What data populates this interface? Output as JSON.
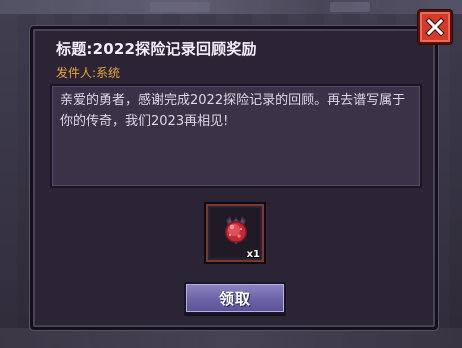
{
  "mail": {
    "title": "标题:2022探险记录回顾奖励",
    "sender": "发件人:系统",
    "body": "亲爱的勇者，感谢完成2022探险记录的回顾。再去谱写属于你的传奇，我们2023再相见!"
  },
  "reward": {
    "icon": "red-gem-icon",
    "count": "x1"
  },
  "claim_button": {
    "label": "领取"
  },
  "close_button": {
    "icon": "close-icon"
  },
  "colors": {
    "sender": "#e8a63a",
    "close_button": "#d23a2a",
    "claim_button": "#6c63a8",
    "panel": "#2b2434"
  }
}
